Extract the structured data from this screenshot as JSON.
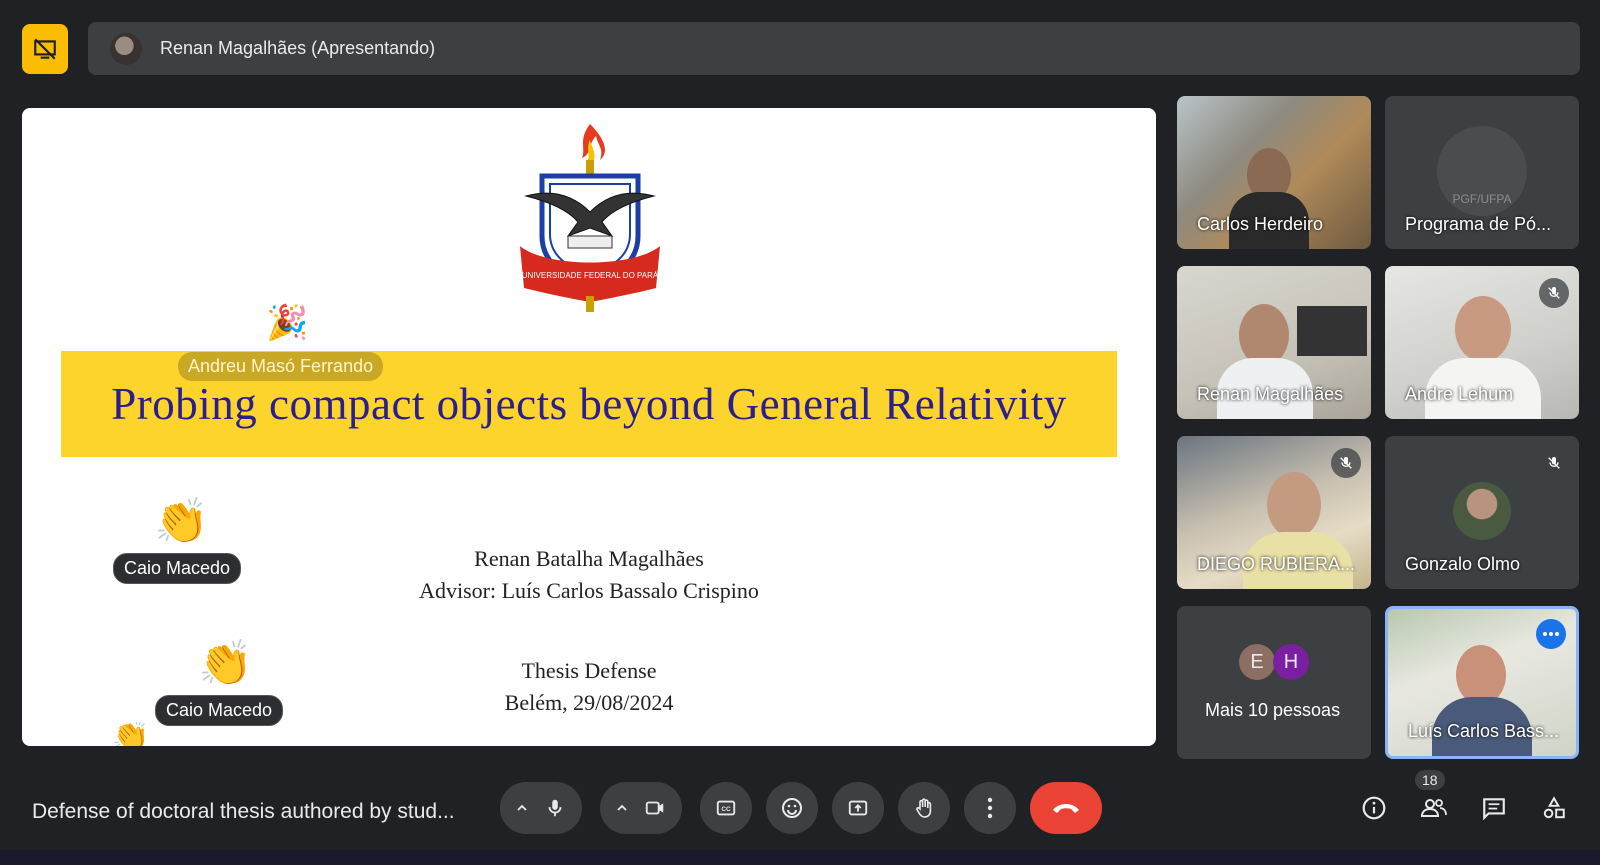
{
  "header": {
    "presenter": "Renan Magalhães (Apresentando)"
  },
  "slide": {
    "crest_text": "UNIVERSIDADE FEDERAL DO PARÁ",
    "title": "Probing compact objects beyond General Relativity",
    "author": "Renan Batalha Magalhães",
    "advisor": "Advisor: Luís Carlos Bassalo Crispino",
    "event": "Thesis Defense",
    "place_date": "Belém, 29/08/2024"
  },
  "reactions": [
    {
      "name": "Andreu Masó Ferrando",
      "emoji": "🎉"
    },
    {
      "name": "Caio Macedo",
      "emoji": "👏"
    },
    {
      "name": "Caio Macedo",
      "emoji": "👏"
    }
  ],
  "participants": [
    {
      "name": "Carlos Herdeiro",
      "muted": false
    },
    {
      "name": "Programa de Pó...",
      "muted": false,
      "logo_text": "PGF/UFPA"
    },
    {
      "name": "Renan Magalhães",
      "muted": false
    },
    {
      "name": "Andre Lehum",
      "muted": true
    },
    {
      "name": "DIEGO RUBIERA...",
      "muted": true
    },
    {
      "name": "Gonzalo Olmo",
      "muted": true
    },
    {
      "name": "Mais 10 pessoas",
      "initials": [
        "E",
        "H"
      ]
    },
    {
      "name": "Luís Carlos Bass...",
      "selected": true
    }
  ],
  "bottom": {
    "meeting_title": "Defense of doctoral thesis authored by stud...",
    "participant_count": "18"
  },
  "colors": {
    "background": "#202124",
    "accent_yellow": "#fbbc04",
    "banner": "#fcd42c",
    "title_blue": "#2b1f8f",
    "hangup": "#ea4335",
    "selected_border": "#8ab4f8"
  }
}
